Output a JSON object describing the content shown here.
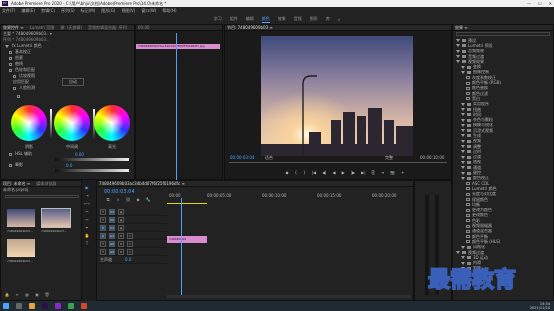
{
  "app": {
    "title": "Adobe Premiere Pro 2020 - C:\\用户\\bhju\\文档\\Adobe\\Premiere Pro\\14.0\\未命名 *",
    "window_controls": [
      "—",
      "☐",
      "✕"
    ]
  },
  "menu": [
    "文件(F)",
    "编辑(E)",
    "剪辑(C)",
    "序列(S)",
    "标记(M)",
    "图形(G)",
    "视图(V)",
    "窗口(W)",
    "帮助(H)"
  ],
  "workspaces": [
    {
      "label": "学习",
      "active": false
    },
    {
      "label": "组件",
      "active": false
    },
    {
      "label": "编辑",
      "active": false
    },
    {
      "label": "颜色",
      "active": true
    },
    {
      "label": "效果",
      "active": false
    },
    {
      "label": "音频",
      "active": false
    },
    {
      "label": "图形",
      "active": false
    },
    {
      "label": "库",
      "active": false
    },
    {
      "label": "»",
      "active": false
    }
  ],
  "left_panel": {
    "tabs": [
      "效果控件 ≡",
      "Lumetri 范围",
      "源: (无剪辑)",
      "音频剪辑混合器: 序列"
    ],
    "master": "主要 * 748049609b03.. ▾",
    "clip": "序列 * 748049609b03..",
    "rows": [
      "fx  Lumetri 颜色",
      "基本校正",
      "创意",
      "曲线",
      "色轮和匹配",
      "比较视图",
      "应用匹配",
      "人脸检测",
      "HSL 辅助",
      "晕影"
    ],
    "auto": "自动",
    "wheel_labels": [
      "阴影",
      "中间调",
      "高光"
    ],
    "values": [
      "0.00",
      "0.0",
      "100.0"
    ]
  },
  "source_panel": {
    "timecode": "00:00",
    "clip_label": "748049609b03ac34b4d07f6f25f0196dfc.jpg"
  },
  "program": {
    "tab": "节目: 748049609b03 ≡",
    "timecode_left": "00:00:03:04",
    "fit": "适合",
    "quality": "完整",
    "timecode_right": "00:00:10:00",
    "controls": [
      "◆",
      "{",
      "}",
      "|◀",
      "◀|",
      "◀",
      "▶",
      "|▶",
      "▶|",
      "⎘",
      "⇥",
      "📷",
      "+"
    ]
  },
  "project": {
    "tabs": [
      "项目: 未命名 ≡",
      "媒体浏览器"
    ],
    "search_label": "未命名.prproj",
    "items": [
      {
        "name": "748049609b03...",
        "dur": "5:00"
      },
      {
        "name": "748049609b03...",
        "dur": "5:00"
      },
      {
        "name": "748049609b03...",
        "dur": "5:00"
      }
    ]
  },
  "timeline": {
    "tab": "748049609b03ac34b4d07f6f25f0196dfc ≡",
    "timecode": "00:00:03:04",
    "ruler": [
      "00:00",
      "00:00:05:00",
      "00:00:10:00",
      "00:00:15:00",
      "00:00:20:00"
    ],
    "video_tracks": [
      "V3",
      "V2",
      "V1"
    ],
    "audio_tracks": [
      "A1",
      "A2",
      "A3"
    ],
    "master": "主声道",
    "master_value": "0.0",
    "clip": "748049609"
  },
  "effects": {
    "tab": "效果 ≡",
    "items": [
      {
        "label": "预设",
        "indent": 0,
        "type": "folder"
      },
      {
        "label": "Lumetri 预设",
        "indent": 0,
        "type": "folder"
      },
      {
        "label": "音频效果",
        "indent": 0,
        "type": "folder"
      },
      {
        "label": "音频过渡",
        "indent": 0,
        "type": "folder"
      },
      {
        "label": "视频效果",
        "indent": 0,
        "type": "folder"
      },
      {
        "label": "变换",
        "indent": 1,
        "type": "folder"
      },
      {
        "label": "图像控制",
        "indent": 1,
        "type": "folder"
      },
      {
        "label": "灰度系数校正",
        "indent": 2,
        "type": "fx"
      },
      {
        "label": "颜色平衡 (RGB)",
        "indent": 2,
        "type": "fx"
      },
      {
        "label": "颜色替换",
        "indent": 2,
        "type": "fx"
      },
      {
        "label": "颜色过滤",
        "indent": 2,
        "type": "fx"
      },
      {
        "label": "黑白",
        "indent": 2,
        "type": "fx"
      },
      {
        "label": "实用程序",
        "indent": 1,
        "type": "folder"
      },
      {
        "label": "扭曲",
        "indent": 1,
        "type": "folder"
      },
      {
        "label": "时间",
        "indent": 1,
        "type": "folder"
      },
      {
        "label": "杂色与颗粒",
        "indent": 1,
        "type": "folder"
      },
      {
        "label": "模糊与锐化",
        "indent": 1,
        "type": "folder"
      },
      {
        "label": "沉浸式视频",
        "indent": 1,
        "type": "folder"
      },
      {
        "label": "生成",
        "indent": 1,
        "type": "folder"
      },
      {
        "label": "视频",
        "indent": 1,
        "type": "folder"
      },
      {
        "label": "调整",
        "indent": 1,
        "type": "folder"
      },
      {
        "label": "过时",
        "indent": 1,
        "type": "folder"
      },
      {
        "label": "过渡",
        "indent": 1,
        "type": "folder"
      },
      {
        "label": "透视",
        "indent": 1,
        "type": "folder"
      },
      {
        "label": "通道",
        "indent": 1,
        "type": "folder"
      },
      {
        "label": "键控",
        "indent": 1,
        "type": "folder"
      },
      {
        "label": "颜色校正",
        "indent": 1,
        "type": "folder"
      },
      {
        "label": "ASC CDL",
        "indent": 2,
        "type": "fx"
      },
      {
        "label": "Lumetri 颜色",
        "indent": 2,
        "type": "fx"
      },
      {
        "label": "亮度与对比度",
        "indent": 2,
        "type": "fx"
      },
      {
        "label": "保留颜色",
        "indent": 2,
        "type": "fx"
      },
      {
        "label": "均衡",
        "indent": 2,
        "type": "fx"
      },
      {
        "label": "更改为颜色",
        "indent": 2,
        "type": "fx"
      },
      {
        "label": "更改颜色",
        "indent": 2,
        "type": "fx"
      },
      {
        "label": "色彩",
        "indent": 2,
        "type": "fx"
      },
      {
        "label": "视频限幅器",
        "indent": 2,
        "type": "fx"
      },
      {
        "label": "通道混合器",
        "indent": 2,
        "type": "fx"
      },
      {
        "label": "颜色平衡",
        "indent": 2,
        "type": "fx"
      },
      {
        "label": "颜色平衡 (HLS)",
        "indent": 2,
        "type": "fx"
      },
      {
        "label": "风格化",
        "indent": 1,
        "type": "folder"
      },
      {
        "label": "视频过渡",
        "indent": 0,
        "type": "folder"
      },
      {
        "label": "3D 运动",
        "indent": 1,
        "type": "folder"
      },
      {
        "label": "内滑",
        "indent": 1,
        "type": "folder"
      },
      {
        "label": "划像",
        "indent": 1,
        "type": "folder"
      },
      {
        "label": "擦除",
        "indent": 1,
        "type": "folder"
      },
      {
        "label": "沉浸式视频",
        "indent": 1,
        "type": "folder"
      },
      {
        "label": "溶解",
        "indent": 1,
        "type": "folder"
      }
    ]
  },
  "watermark": "最需教育",
  "taskbar": {
    "time": "15:34",
    "date": "2021/11/24"
  }
}
